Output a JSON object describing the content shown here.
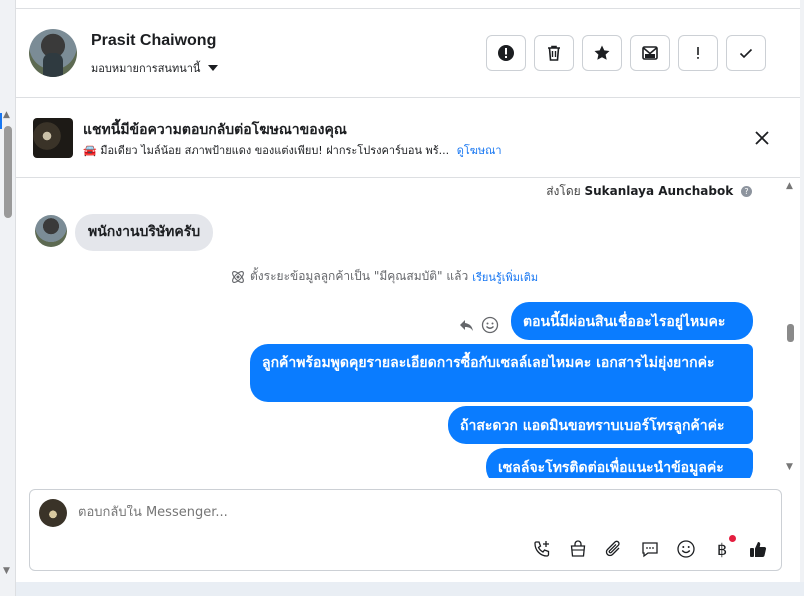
{
  "header": {
    "contact_name": "Prasit Chaiwong",
    "assign_label": "มอบหมายการสนทนานี้",
    "actions": [
      {
        "name": "spam-icon"
      },
      {
        "name": "trash-icon"
      },
      {
        "name": "star-icon"
      },
      {
        "name": "mark-unread-icon"
      },
      {
        "name": "follow-up-icon"
      },
      {
        "name": "done-check-icon"
      }
    ]
  },
  "ad_banner": {
    "title": "แชทนี้มีข้อความตอบกลับต่อโฆษณาของคุณ",
    "subtitle": "🚘 มือเดียว ไมล์น้อย สภาพป้ายแดง ของแต่งเพียบ! ฝากระโปรงคาร์บอน พร้...",
    "link": "ดูโฆษณา"
  },
  "conversation": {
    "sent_by_prefix": "ส่งโดย",
    "sent_by_name": "Sukanlaya Aunchabok",
    "incoming_message": "พนักงานบริษัทครับ",
    "system_note": "ตั้งระยะข้อมูลลูกค้าเป็น \"มีคุณสมบัติ\" แล้ว",
    "system_note_link": "เรียนรู้เพิ่มเติม",
    "outgoing_messages": [
      "ตอนนี้มีผ่อนสินเชื่ออะไรอยู่ไหมคะ",
      "ลูกค้าพร้อมพูดคุยรายละเอียดการซื้อกับเซลล์เลยไหมคะ เอกสารไม่ยุ่งยากค่ะ",
      "ถ้าสะดวก แอดมินขอทราบเบอร์โทรลูกค้าค่ะ",
      "เซลล์จะโทรติดต่อเพื่อแนะนำข้อมูลค่ะ"
    ]
  },
  "composer": {
    "placeholder": "ตอบกลับใน Messenger...",
    "tools": [
      "call-add-icon",
      "shop-bag-icon",
      "attachment-icon",
      "saved-replies-icon",
      "emoji-icon",
      "baht-payment-icon",
      "thumbs-up-icon"
    ]
  },
  "colors": {
    "accent": "#0a7cff",
    "link": "#1877f2",
    "incoming_bubble": "#e4e6eb"
  }
}
